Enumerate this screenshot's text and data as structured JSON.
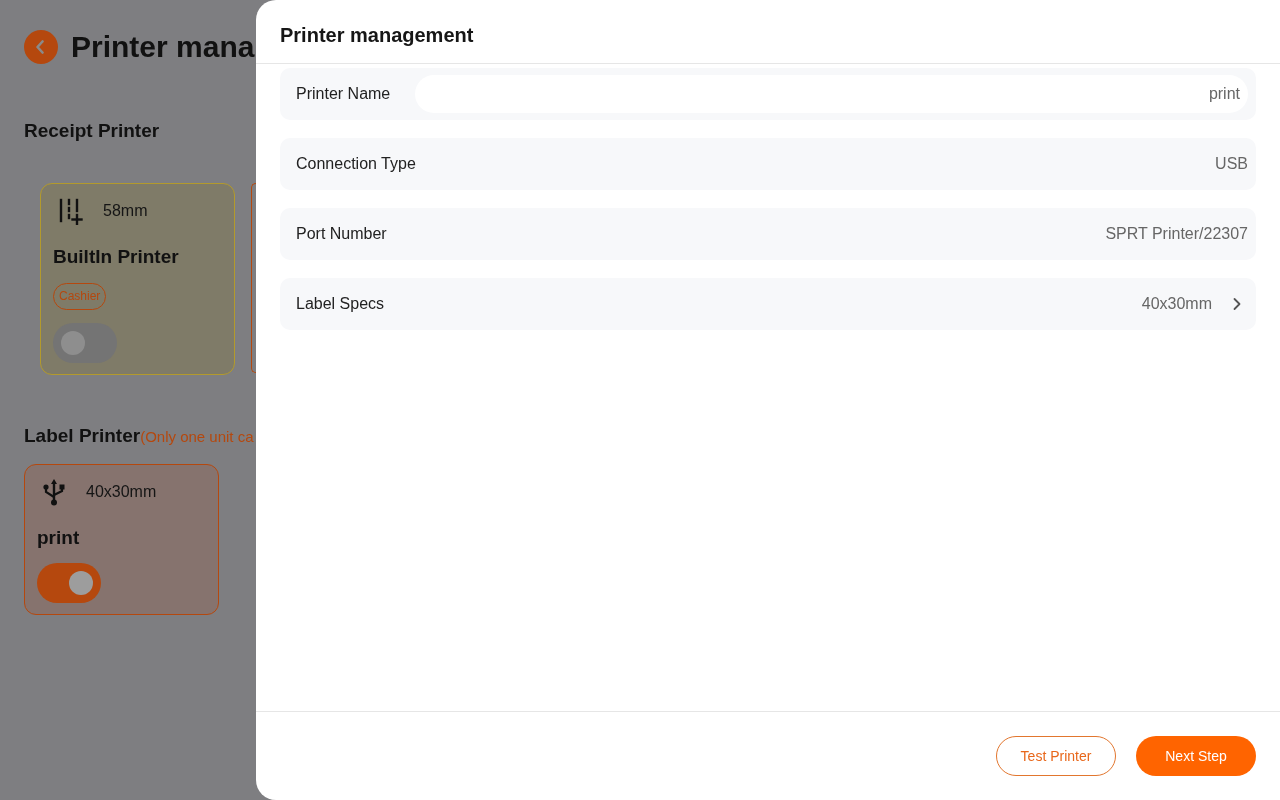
{
  "page": {
    "title": "Printer mana"
  },
  "receipt_section": {
    "title": "Receipt Printer",
    "printers": [
      {
        "kind": "builtin",
        "size": "58mm",
        "name": "BuiltIn Printer",
        "tag": "Cashier",
        "on": false
      }
    ]
  },
  "label_section": {
    "title": "Label Printer",
    "note": "(Only one unit ca",
    "printers": [
      {
        "kind": "usb",
        "size": "40x30mm",
        "name": "print",
        "on": true
      }
    ]
  },
  "drawer": {
    "title": "Printer management",
    "fields": [
      {
        "kind": "input",
        "label": "Printer Name",
        "value": "print"
      },
      {
        "kind": "text",
        "label": "Connection Type",
        "value": "USB"
      },
      {
        "kind": "text",
        "label": "Port Number",
        "value": "SPRT Printer/22307"
      },
      {
        "kind": "link",
        "label": "Label Specs",
        "value": "40x30mm"
      }
    ],
    "buttons": [
      {
        "kind": "outline",
        "label": "Test Printer"
      },
      {
        "kind": "primary",
        "label": "Next Step"
      }
    ]
  }
}
